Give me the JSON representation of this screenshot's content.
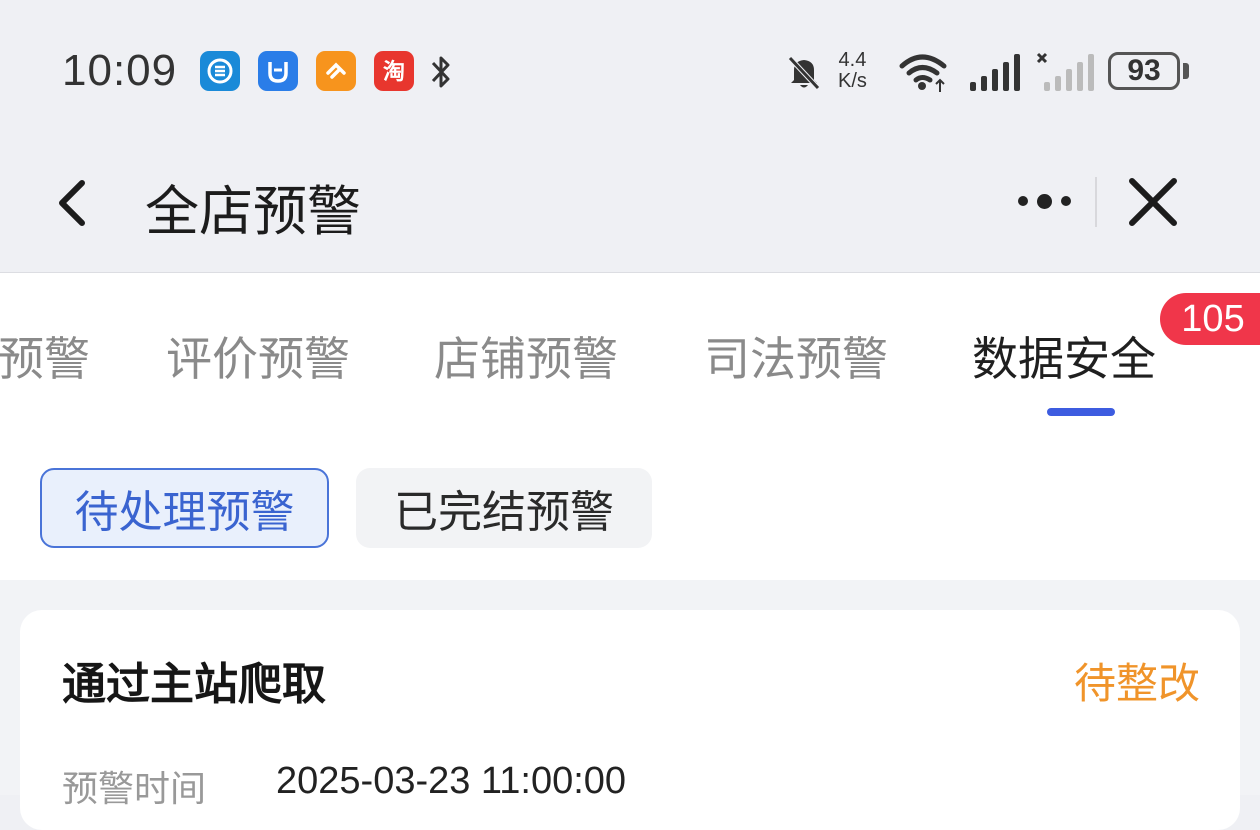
{
  "status_bar": {
    "time": "10:09",
    "app_icons": [
      {
        "name": "list-app-icon",
        "color": "#1a8ad8",
        "glyph": "≡"
      },
      {
        "name": "ox-app-icon",
        "color": "#2a7de8",
        "glyph": "Ü"
      },
      {
        "name": "heart-app-icon",
        "color": "#f7941d",
        "glyph": "♥"
      },
      {
        "name": "taobao-app-icon",
        "color": "#e8362e",
        "glyph": "淘"
      }
    ],
    "network_speed_value": "4.4",
    "network_speed_unit": "K/s",
    "battery": "93"
  },
  "nav": {
    "title": "全店预警"
  },
  "tabs": {
    "items": [
      {
        "label": "预警",
        "active": false
      },
      {
        "label": "评价预警",
        "active": false
      },
      {
        "label": "店铺预警",
        "active": false
      },
      {
        "label": "司法预警",
        "active": false
      },
      {
        "label": "数据安全",
        "active": true
      }
    ],
    "badge": "105"
  },
  "filters": {
    "pending": "待处理预警",
    "completed": "已完结预警"
  },
  "card": {
    "title": "通过主站爬取",
    "status": "待整改",
    "field_label": "预警时间",
    "field_value": "2025-03-23 11:00:00"
  },
  "colors": {
    "accent": "#3d5ce0",
    "badge": "#f0364a",
    "status_pending": "#f0942a"
  }
}
